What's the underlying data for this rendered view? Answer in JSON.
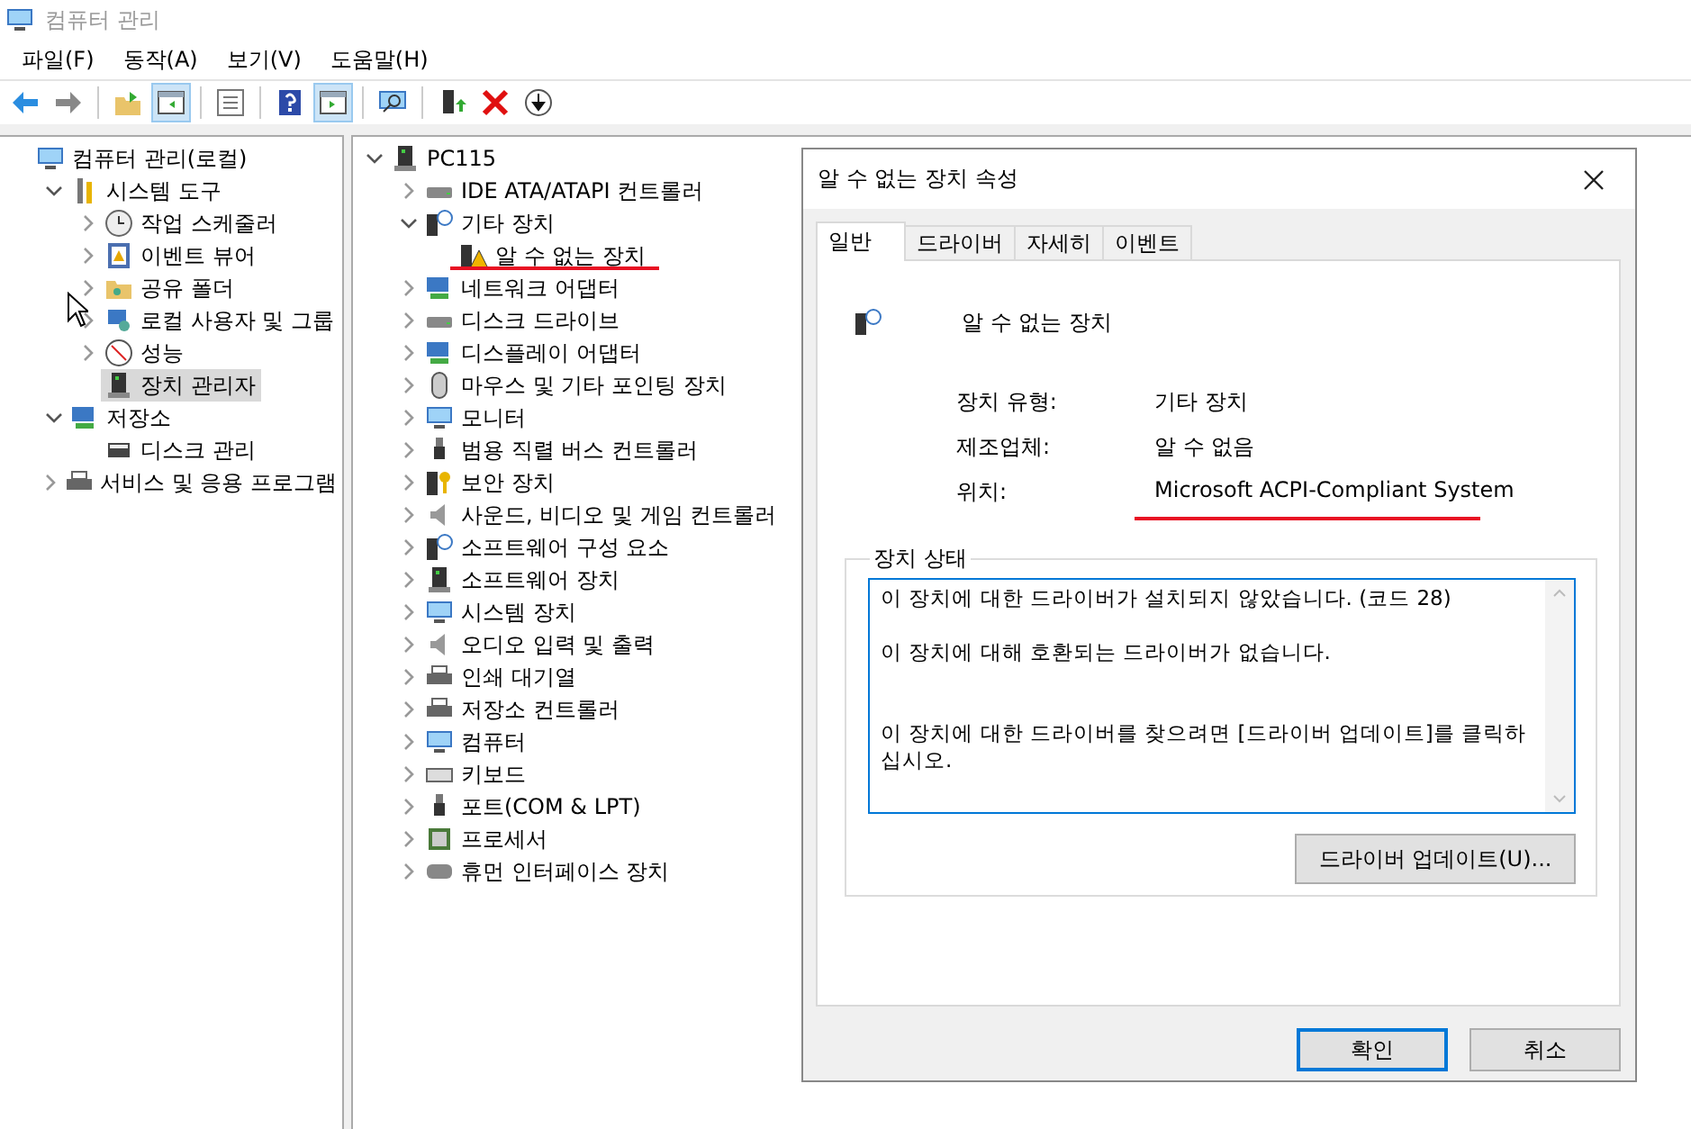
{
  "window": {
    "title": "컴퓨터 관리",
    "active": false
  },
  "menu": [
    {
      "label": "파일(F)"
    },
    {
      "label": "동작(A)"
    },
    {
      "label": "보기(V)"
    },
    {
      "label": "도움말(H)"
    }
  ],
  "toolbar": [
    {
      "kind": "button",
      "pressed": false
    },
    {
      "kind": "button",
      "pressed": false
    },
    {
      "kind": "separator"
    },
    {
      "kind": "button",
      "pressed": false
    },
    {
      "kind": "button",
      "pressed": true
    },
    {
      "kind": "separator"
    },
    {
      "kind": "button",
      "pressed": false
    },
    {
      "kind": "separator"
    },
    {
      "kind": "button",
      "pressed": false
    },
    {
      "kind": "button",
      "pressed": true
    },
    {
      "kind": "separator"
    },
    {
      "kind": "button",
      "pressed": false
    },
    {
      "kind": "separator"
    },
    {
      "kind": "button",
      "pressed": false
    },
    {
      "kind": "button",
      "pressed": false
    },
    {
      "kind": "button",
      "pressed": false
    }
  ],
  "left_tree": {
    "items": [
      {
        "label": "컴퓨터 관리(로컬)",
        "kind": "root",
        "selected": false,
        "children": [
          {
            "label": "시스템 도구",
            "kind": "branch",
            "expanded": true,
            "selected": false,
            "children": [
              {
                "label": "작업 스케줄러",
                "kind": "branch",
                "expanded": false,
                "selected": false
              },
              {
                "label": "이벤트 뷰어",
                "kind": "branch",
                "expanded": false,
                "selected": false
              },
              {
                "label": "공유 폴더",
                "kind": "branch",
                "expanded": false,
                "selected": false
              },
              {
                "label": "로컬 사용자 및 그룹",
                "kind": "branch",
                "expanded": false,
                "selected": false
              },
              {
                "label": "성능",
                "kind": "branch",
                "expanded": false,
                "selected": false
              },
              {
                "label": "장치 관리자",
                "kind": "leaf",
                "selected": true
              }
            ]
          },
          {
            "label": "저장소",
            "kind": "branch",
            "expanded": true,
            "selected": false,
            "children": [
              {
                "label": "디스크 관리",
                "kind": "leaf",
                "selected": false
              }
            ]
          },
          {
            "label": "서비스 및 응용 프로그램",
            "kind": "branch",
            "expanded": false,
            "selected": false
          }
        ]
      }
    ]
  },
  "device_tree": {
    "items": [
      {
        "label": "PC115",
        "kind": "branch",
        "expanded": true,
        "children": [
          {
            "label": "IDE ATA/ATAPI 컨트롤러",
            "kind": "branch",
            "expanded": false
          },
          {
            "label": "기타 장치",
            "kind": "branch",
            "expanded": true,
            "children": [
              {
                "label": "알 수 없는 장치",
                "kind": "leaf",
                "warning": true
              }
            ]
          },
          {
            "label": "네트워크 어댑터",
            "kind": "branch",
            "expanded": false
          },
          {
            "label": "디스크 드라이브",
            "kind": "branch",
            "expanded": false
          },
          {
            "label": "디스플레이 어댑터",
            "kind": "branch",
            "expanded": false
          },
          {
            "label": "마우스 및 기타 포인팅 장치",
            "kind": "branch",
            "expanded": false
          },
          {
            "label": "모니터",
            "kind": "branch",
            "expanded": false
          },
          {
            "label": "범용 직렬 버스 컨트롤러",
            "kind": "branch",
            "expanded": false
          },
          {
            "label": "보안 장치",
            "kind": "branch",
            "expanded": false
          },
          {
            "label": "사운드, 비디오 및 게임 컨트롤러",
            "kind": "branch",
            "expanded": false
          },
          {
            "label": "소프트웨어 구성 요소",
            "kind": "branch",
            "expanded": false
          },
          {
            "label": "소프트웨어 장치",
            "kind": "branch",
            "expanded": false
          },
          {
            "label": "시스템 장치",
            "kind": "branch",
            "expanded": false
          },
          {
            "label": "오디오 입력 및 출력",
            "kind": "branch",
            "expanded": false
          },
          {
            "label": "인쇄 대기열",
            "kind": "branch",
            "expanded": false
          },
          {
            "label": "저장소 컨트롤러",
            "kind": "branch",
            "expanded": false
          },
          {
            "label": "컴퓨터",
            "kind": "branch",
            "expanded": false
          },
          {
            "label": "키보드",
            "kind": "branch",
            "expanded": false
          },
          {
            "label": "포트(COM & LPT)",
            "kind": "branch",
            "expanded": false
          },
          {
            "label": "프로세서",
            "kind": "branch",
            "expanded": false
          },
          {
            "label": "휴먼 인터페이스 장치",
            "kind": "branch",
            "expanded": false
          }
        ]
      }
    ]
  },
  "dialog": {
    "title": "알 수 없는 장치 속성",
    "tabs": [
      {
        "label": "일반",
        "selected": true
      },
      {
        "label": "드라이버",
        "selected": false
      },
      {
        "label": "자세히",
        "selected": false
      },
      {
        "label": "이벤트",
        "selected": false
      }
    ],
    "device_name": "알 수 없는 장치",
    "properties": [
      {
        "label": "장치 유형:",
        "value": "기타 장치"
      },
      {
        "label": "제조업체:",
        "value": "알 수 없음"
      },
      {
        "label": "위치:",
        "value": "Microsoft ACPI-Compliant System"
      }
    ],
    "status_group": {
      "title": "장치 상태",
      "text": "이 장치에 대한 드라이버가 설치되지 않았습니다. (코드 28)\n\n이 장치에 대해 호환되는 드라이버가 없습니다.\n\n\n이 장치에 대한 드라이버를 찾으려면 [드라이버 업데이트]를 클릭하십시오.",
      "button": "드라이버 업데이트(U)..."
    },
    "buttons": [
      {
        "label": "확인",
        "default": true
      },
      {
        "label": "취소",
        "default": false
      }
    ]
  }
}
